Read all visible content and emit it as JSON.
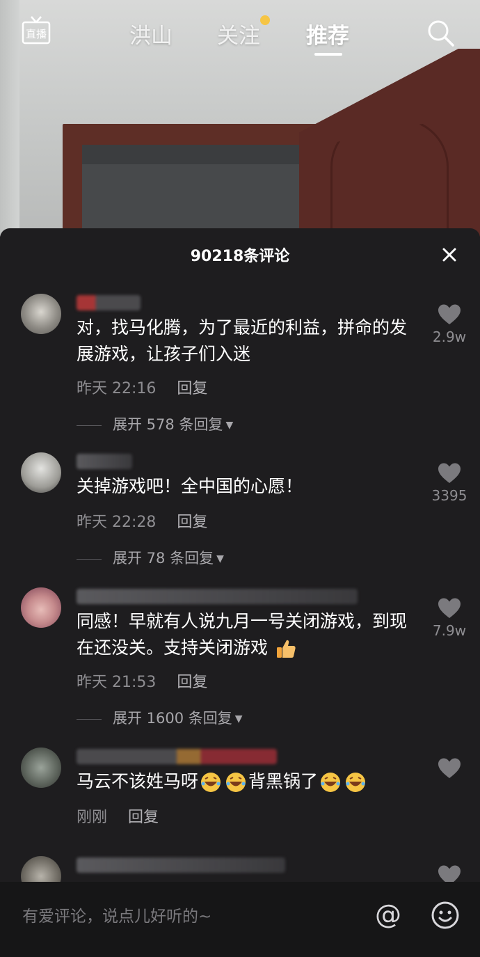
{
  "nav": {
    "tabs": [
      {
        "label": "洪山",
        "active": false
      },
      {
        "label": "关注",
        "active": false,
        "has_dot": true
      },
      {
        "label": "推荐",
        "active": true
      }
    ],
    "live_icon": "live-broadcast-icon",
    "search_icon": "search-icon"
  },
  "comments_panel": {
    "title": "90218条评论",
    "close_icon": "close-icon"
  },
  "comments": [
    {
      "text": "对，找马化腾，为了最近的利益，拼命的发展游戏，让孩子们入迷",
      "time": "昨天 22:16",
      "reply_label": "回复",
      "expand_label": "展开 578 条回复",
      "likes": "2.9w"
    },
    {
      "text": "关掉游戏吧！全中国的心愿！",
      "time": "昨天 22:28",
      "reply_label": "回复",
      "expand_label": "展开 78 条回复",
      "likes": "3395"
    },
    {
      "text": "同感！早就有人说九月一号关闭游戏，到现在还没关。支持关闭游戏",
      "time": "昨天 21:53",
      "reply_label": "回复",
      "expand_label": "展开 1600 条回复",
      "likes": "7.9w"
    },
    {
      "text_a": "马云不该姓马呀",
      "text_b": "背黑锅了",
      "time": "刚刚",
      "reply_label": "回复",
      "likes": ""
    }
  ],
  "input": {
    "placeholder": "有爱评论，说点儿好听的~",
    "at_label": "@"
  },
  "colors": {
    "panel_bg": "#1e1d1f",
    "accent_dot": "#f6c544",
    "muted_text": "#8e8d91"
  }
}
